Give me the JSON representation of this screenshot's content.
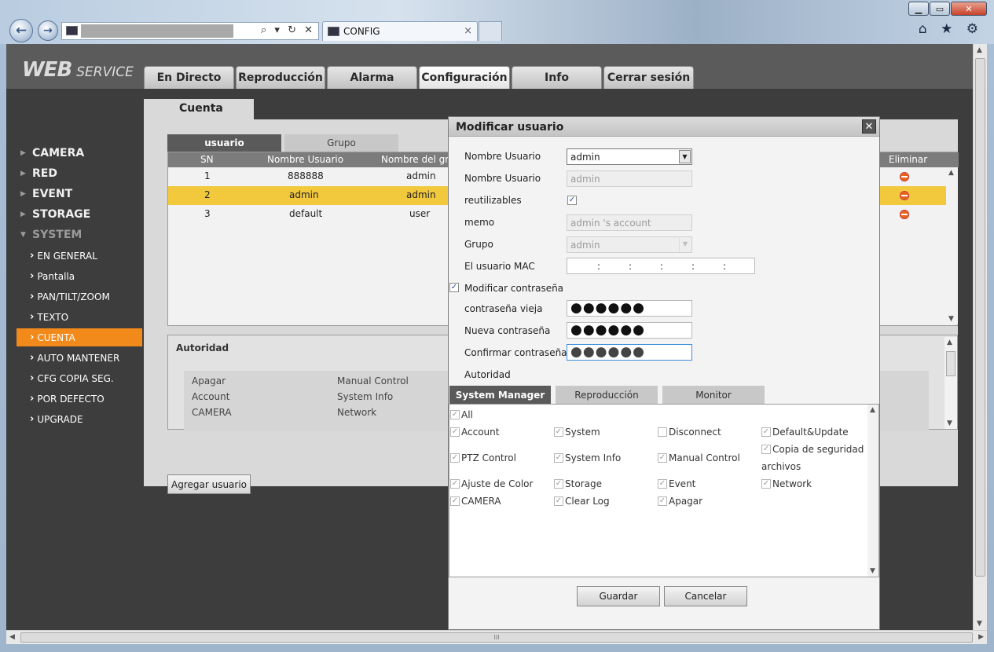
{
  "browser": {
    "tab_title": "CONFIG",
    "tab_close": "×",
    "address_icons": "⌕ ▾ ↻ ✕",
    "back": "←",
    "forward": "→",
    "win_min": "▁",
    "win_max": "▭",
    "win_close": "✕",
    "right_icons": "⌂ ★ ⚙",
    "hscroll_grip": "III"
  },
  "app": {
    "logo_main": "WEB",
    "logo_sub": "SERVICE",
    "tabs": [
      "En Directo",
      "Reproducción",
      "Alarma",
      "Configuración",
      "Info",
      "Cerrar sesión"
    ],
    "active_tab": "Configuración"
  },
  "sidebar": {
    "sections": [
      "CAMERA",
      "RED",
      "EVENT",
      "STORAGE",
      "SYSTEM"
    ],
    "sub": [
      "EN GENERAL",
      "Pantalla",
      "PAN/TILT/ZOOM",
      "TEXTO",
      "CUENTA",
      "AUTO MANTENER",
      "CFG COPIA SEG.",
      "POR DEFECTO",
      "UPGRADE"
    ],
    "active_sub": "CUENTA"
  },
  "page": {
    "section_tab": "Cuenta",
    "subtabs": [
      "usuario",
      "Grupo"
    ],
    "columns": [
      "SN",
      "Nombre Usuario",
      "Nombre del gru",
      "Eliminar"
    ],
    "rows": [
      {
        "sn": "1",
        "name": "888888",
        "group": "admin"
      },
      {
        "sn": "2",
        "name": "admin",
        "group": "admin"
      },
      {
        "sn": "3",
        "name": "default",
        "group": "user"
      }
    ],
    "selected_row": "2",
    "autoridad_title": "Autoridad",
    "autoridad_items": [
      "Apagar",
      "Manual Control",
      "Account",
      "System Info",
      "CAMERA",
      "Network"
    ],
    "add_user": "Agregar usuario"
  },
  "modal": {
    "title": "Modificar usuario",
    "close": "✕",
    "labels": {
      "user_select": "Nombre Usuario",
      "user_name": "Nombre Usuario",
      "reusable": "reutilizables",
      "memo": "memo",
      "group": "Grupo",
      "mac": "El usuario MAC",
      "modify_pwd": "Modificar contraseña",
      "old_pwd": "contraseña vieja",
      "new_pwd": "Nueva contraseña",
      "confirm_pwd": "Confirmar contraseña",
      "autoridad": "Autoridad"
    },
    "values": {
      "user_select": "admin",
      "user_name": "admin",
      "memo": "admin 's account",
      "group": "admin",
      "mac_sep": ":",
      "pwd_mask": "●●●●●●",
      "check": "✓"
    },
    "perm_tabs": [
      "System Manager",
      "Reproducción",
      "Monitor"
    ],
    "perm_items": [
      {
        "label": "All",
        "checked": true
      },
      {
        "label": "Account",
        "checked": true
      },
      {
        "label": "System",
        "checked": true
      },
      {
        "label": "Disconnect",
        "checked": false
      },
      {
        "label": "Default&Update",
        "checked": true
      },
      {
        "label": "PTZ Control",
        "checked": true
      },
      {
        "label": "System Info",
        "checked": true
      },
      {
        "label": "Manual Control",
        "checked": true
      },
      {
        "label": "Copia de seguridad",
        "checked": true
      },
      {
        "label": "archivos",
        "checked": false
      },
      {
        "label": "Ajuste de Color",
        "checked": true
      },
      {
        "label": "Storage",
        "checked": true
      },
      {
        "label": "Event",
        "checked": true
      },
      {
        "label": "Network",
        "checked": true
      },
      {
        "label": "CAMERA",
        "checked": true
      },
      {
        "label": "Clear Log",
        "checked": true
      },
      {
        "label": "Apagar",
        "checked": true
      }
    ],
    "save": "Guardar",
    "cancel": "Cancelar"
  },
  "colors": {
    "accent": "#f28a1b",
    "selected_row": "#f2c93c",
    "delete": "#e8641c"
  }
}
